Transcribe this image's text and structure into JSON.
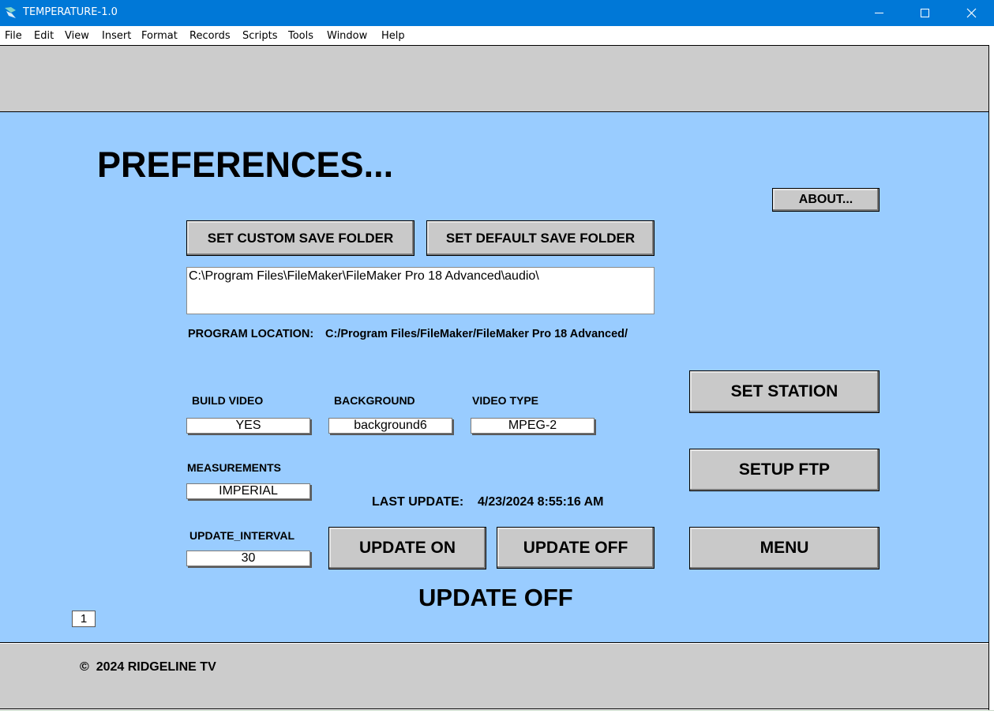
{
  "window": {
    "title": "TEMPERATURE-1.0",
    "minimize_glyph": "—",
    "maximize_glyph": "☐",
    "close_glyph": "✕"
  },
  "menubar": {
    "items": [
      "File",
      "Edit",
      "View",
      "Insert",
      "Format",
      "Records",
      "Scripts",
      "Tools",
      "Window",
      "Help"
    ]
  },
  "main": {
    "heading": "PREFERENCES...",
    "about_button": "ABOUT...",
    "set_custom_save_folder_button": "SET CUSTOM SAVE FOLDER",
    "set_default_save_folder_button": "SET DEFAULT SAVE FOLDER",
    "save_folder_path": "C:\\Program Files\\FileMaker\\FileMaker Pro 18 Advanced\\audio\\",
    "program_location_label": "PROGRAM LOCATION:",
    "program_location_value": "C:/Program Files/FileMaker/FileMaker Pro 18 Advanced/",
    "build_video_label": "BUILD VIDEO",
    "build_video_value": "YES",
    "background_label": "BACKGROUND",
    "background_value": "background6",
    "video_type_label": "VIDEO TYPE",
    "video_type_value": "MPEG-2",
    "measurements_label": "MEASUREMENTS",
    "measurements_value": "IMPERIAL",
    "last_update_label": "LAST UPDATE:",
    "last_update_value": "4/23/2024 8:55:16 AM",
    "update_interval_label": "UPDATE_INTERVAL",
    "update_interval_value": "30",
    "update_on_button": "UPDATE ON",
    "update_off_button": "UPDATE OFF",
    "update_status": "UPDATE OFF",
    "set_station_button": "SET STATION",
    "setup_ftp_button": "SETUP FTP",
    "menu_button": "MENU",
    "record_number": "1"
  },
  "footer": {
    "copyright_symbol": "©",
    "copyright_text": "2024 RIDGELINE TV"
  },
  "colors": {
    "titlebar": "#0078d7",
    "body_background": "#99ccff",
    "band_background": "#cccccc",
    "button_face": "#c9c9c9"
  }
}
